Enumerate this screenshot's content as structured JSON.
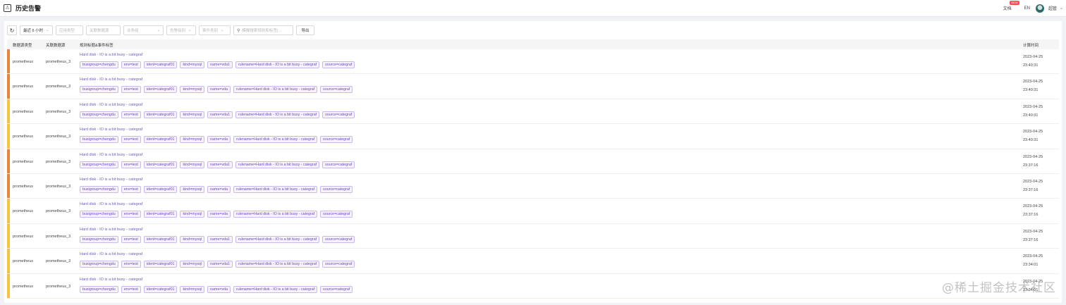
{
  "app": {
    "page_title": "历史告警",
    "docs_label": "文档",
    "new_badge": "NEW",
    "lang": "EN",
    "username": "超管"
  },
  "toolbar": {
    "time_range": "最近 6 小时",
    "filter_app": "应用类型",
    "filter_datasource": "关联数据源",
    "filter_busi": "业务组",
    "filter_severity": "告警级别",
    "filter_event_type": "事件类别",
    "search_placeholder": "模糊搜索规则和标签(...",
    "export_label": "导出"
  },
  "table": {
    "columns": [
      "数据源类型",
      "关联数据源",
      "规则标题&事件标签",
      "计算时间"
    ],
    "severity_colors": {
      "orange": "#e8833a",
      "yellow": "#f5c242"
    },
    "rows": [
      {
        "severity": "orange",
        "type": "prometheus",
        "source": "prometheus_3",
        "title": "Hard disk - IO is a bit busy - categraf",
        "tags": [
          "busigroup=chengdu",
          "env=test",
          "ident=categraf01",
          "kind=mysql",
          "name=vda1",
          "rulename=Hard disk - IO is a bit busy - categraf",
          "source=categraf"
        ],
        "date": "2023-04-25",
        "time": "23:40:31"
      },
      {
        "severity": "orange",
        "type": "prometheus",
        "source": "prometheus_3",
        "title": "Hard disk - IO is a bit busy - categraf",
        "tags": [
          "busigroup=chengdu",
          "env=test",
          "ident=categraf01",
          "kind=mysql",
          "name=vda",
          "rulename=Hard disk - IO is a bit busy - categraf",
          "source=categraf"
        ],
        "date": "2023-04-25",
        "time": "23:40:31"
      },
      {
        "severity": "yellow",
        "type": "prometheus",
        "source": "prometheus_3",
        "title": "Hard disk - IO is a bit busy - categraf",
        "tags": [
          "busigroup=chengdu",
          "env=test",
          "ident=categraf01",
          "kind=mysql",
          "name=vda1",
          "rulename=Hard disk - IO is a bit busy - categraf",
          "source=categraf"
        ],
        "date": "2023-04-25",
        "time": "23:40:31"
      },
      {
        "severity": "yellow",
        "type": "prometheus",
        "source": "prometheus_3",
        "title": "Hard disk - IO is a bit busy - categraf",
        "tags": [
          "busigroup=chengdu",
          "env=test",
          "ident=categraf01",
          "kind=mysql",
          "name=vda",
          "rulename=Hard disk - IO is a bit busy - categraf",
          "source=categraf"
        ],
        "date": "2023-04-25",
        "time": "23:40:31"
      },
      {
        "severity": "orange",
        "type": "prometheus",
        "source": "prometheus_3",
        "title": "Hard disk - IO is a bit busy - categraf",
        "tags": [
          "busigroup=chengdu",
          "env=test",
          "ident=categraf01",
          "kind=mysql",
          "name=vda1",
          "rulename=Hard disk - IO is a bit busy - categraf",
          "source=categraf"
        ],
        "date": "2023-04-25",
        "time": "23:37:16"
      },
      {
        "severity": "orange",
        "type": "prometheus",
        "source": "prometheus_3",
        "title": "Hard disk - IO is a bit busy - categraf",
        "tags": [
          "busigroup=chengdu",
          "env=test",
          "ident=categraf01",
          "kind=mysql",
          "name=vda",
          "rulename=Hard disk - IO is a bit busy - categraf",
          "source=categraf"
        ],
        "date": "2023-04-25",
        "time": "23:37:16"
      },
      {
        "severity": "yellow",
        "type": "prometheus",
        "source": "prometheus_3",
        "title": "Hard disk - IO is a bit busy - categraf",
        "tags": [
          "busigroup=chengdu",
          "env=test",
          "ident=categraf01",
          "kind=mysql",
          "name=vda",
          "rulename=Hard disk - IO is a bit busy - categraf",
          "source=categraf"
        ],
        "date": "2023-04-25",
        "time": "23:37:16"
      },
      {
        "severity": "yellow",
        "type": "prometheus",
        "source": "prometheus_3",
        "title": "Hard disk - IO is a bit busy - categraf",
        "tags": [
          "busigroup=chengdu",
          "env=test",
          "ident=categraf01",
          "kind=mysql",
          "name=vda1",
          "rulename=Hard disk - IO is a bit busy - categraf",
          "source=categraf"
        ],
        "date": "2023-04-25",
        "time": "23:37:16"
      },
      {
        "severity": "yellow",
        "type": "prometheus",
        "source": "prometheus_3",
        "title": "Hard disk - IO is a bit busy - categraf",
        "tags": [
          "busigroup=chengdu",
          "env=test",
          "ident=categraf01",
          "kind=mysql",
          "name=vda1",
          "rulename=Hard disk - IO is a bit busy - categraf",
          "source=categraf"
        ],
        "date": "2023-04-25",
        "time": "23:34:01"
      },
      {
        "severity": "yellow",
        "type": "prometheus",
        "source": "prometheus_3",
        "title": "Hard disk - IO is a bit busy - categraf",
        "tags": [
          "busigroup=chengdu",
          "env=test",
          "ident=categraf01",
          "kind=mysql",
          "name=vda",
          "rulename=Hard disk - IO is a bit busy - categraf",
          "source=categraf"
        ],
        "date": "2023-04-25",
        "time": "23:34:01"
      }
    ]
  },
  "watermark": "@稀土掘金技术社区"
}
